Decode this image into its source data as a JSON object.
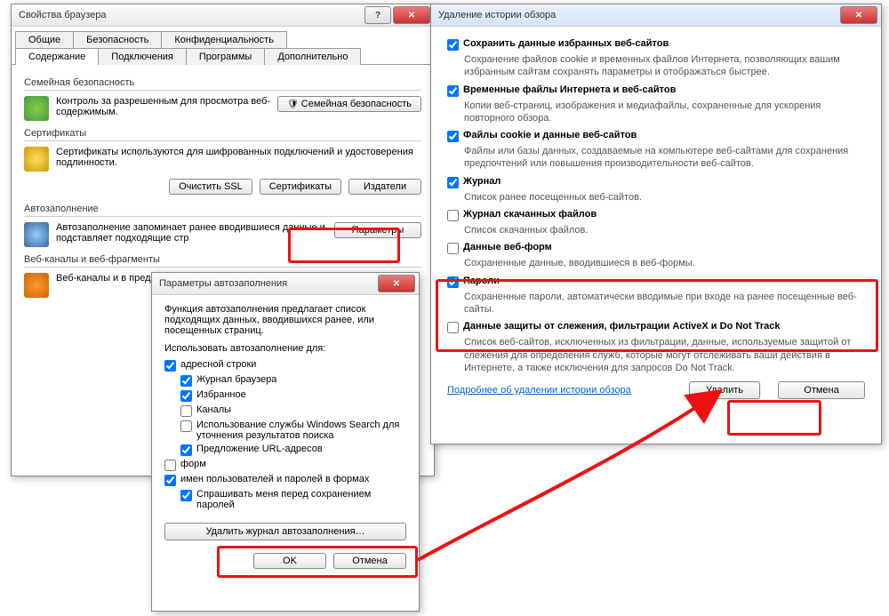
{
  "d1": {
    "title": "Свойства браузера",
    "tabs_top": [
      "Общие",
      "Безопасность",
      "Конфиденциальность"
    ],
    "tabs_bot": [
      "Содержание",
      "Подключения",
      "Программы",
      "Дополнительно"
    ],
    "g1": {
      "label": "Семейная безопасность",
      "text": "Контроль за разрешенным для просмотра веб-содержимым.",
      "btn": "Семейная безопасность"
    },
    "g2": {
      "label": "Сертификаты",
      "text": "Сертификаты используются для шифрованных подключений и удостоверения подлинности.",
      "b1": "Очистить SSL",
      "b2": "Сертификаты",
      "b3": "Издатели"
    },
    "g3": {
      "label": "Автозаполнение",
      "text": "Автозаполнение запоминает ранее вводившиеся данные и подставляет подходящие стр",
      "btn": "Параметры"
    },
    "g4": {
      "label": "Веб-каналы и веб-фрагменты",
      "text": "Веб-каналы и в предоставляют содержимом можно прочит Internet Explore"
    }
  },
  "d2": {
    "title": "Параметры автозаполнения",
    "intro": "Функция автозаполнения предлагает список подходящих данных, вводившихся ранее, или посещенных страниц.",
    "use": "Использовать автозаполнение для:",
    "c1": "адресной строки",
    "c2": "Журнал браузера",
    "c3": "Избранное",
    "c4": "Каналы",
    "c5": "Использование службы Windows Search для уточнения результатов поиска",
    "c6": "Предложение URL-адресов",
    "c7": "форм",
    "c8": "имен пользователей и паролей в формах",
    "c9": "Спрашивать меня перед сохранением паролей",
    "del": "Удалить журнал автозаполнения…",
    "ok": "OK",
    "cancel": "Отмена"
  },
  "d3": {
    "title": "Удаление истории обзора",
    "i1": {
      "h": "Сохранить данные избранных веб-сайтов",
      "d": "Сохранение файлов cookie и временных файлов Интернета, позволяющих вашим избранным сайтам сохранять параметры и отображаться быстрее."
    },
    "i2": {
      "h": "Временные файлы Интернета и веб-сайтов",
      "d": "Копии веб-страниц, изображения и медиафайлы, сохраненные для ускорения повторного обзора."
    },
    "i3": {
      "h": "Файлы cookie и данные веб-сайтов",
      "d": "Файлы или базы данных, создаваемые на компьютере веб-сайтами для сохранения предпочтений или повышения производительности веб-сайтов."
    },
    "i4": {
      "h": "Журнал",
      "d": "Список ранее посещенных веб-сайтов."
    },
    "i5": {
      "h": "Журнал скачанных файлов",
      "d": "Список скачанных файлов."
    },
    "i6": {
      "h": "Данные веб-форм",
      "d": "Сохраненные данные, вводившиеся в веб-формы."
    },
    "i7": {
      "h": "Пароли",
      "d": "Сохраненные пароли, автоматически вводимые при входе на ранее посещенные веб-сайты."
    },
    "i8": {
      "h": "Данные защиты от слежения, фильтрации ActiveX и Do Not Track",
      "d": "Список веб-сайтов, исключенных из фильтрации, данные, используемые защитой от слежения для определения служб, которые могут отслеживать ваши действия в Интернете, а также исключения для запросов Do Not Track."
    },
    "more": "Подробнее об удалении истории обзора",
    "del": "Удалить",
    "cancel": "Отмена"
  }
}
